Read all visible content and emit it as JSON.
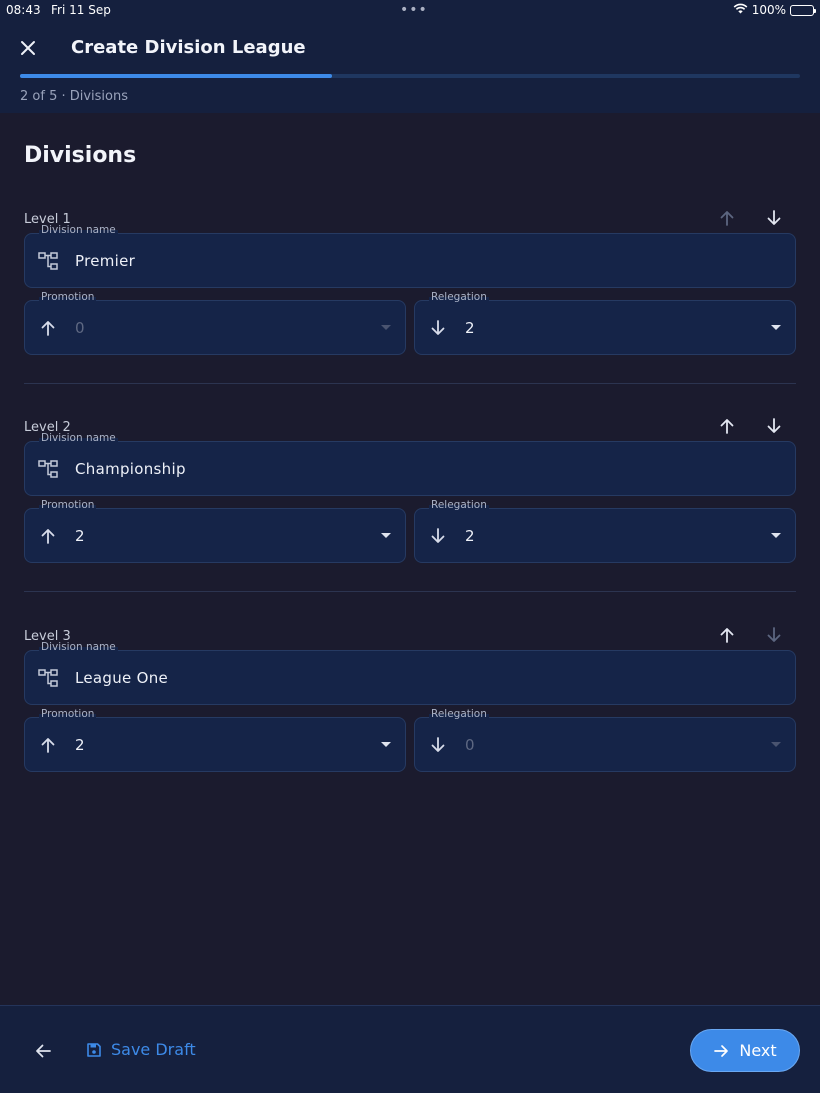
{
  "status_bar": {
    "time": "08:43",
    "date": "Fri 11 Sep",
    "battery": "100%"
  },
  "header": {
    "title": "Create Division League",
    "step_label": "2 of 5 · Divisions",
    "progress_percent": 40
  },
  "section": {
    "title": "Divisions"
  },
  "divisions": [
    {
      "level_label": "Level 1",
      "name_label": "Division name",
      "name_value": "Premier",
      "promotion_label": "Promotion",
      "promotion_value": "0",
      "promotion_disabled": true,
      "relegation_label": "Relegation",
      "relegation_value": "2",
      "relegation_disabled": false,
      "move_up_enabled": false,
      "move_down_enabled": true
    },
    {
      "level_label": "Level 2",
      "name_label": "Division name",
      "name_value": "Championship",
      "promotion_label": "Promotion",
      "promotion_value": "2",
      "promotion_disabled": false,
      "relegation_label": "Relegation",
      "relegation_value": "2",
      "relegation_disabled": false,
      "move_up_enabled": true,
      "move_down_enabled": true
    },
    {
      "level_label": "Level 3",
      "name_label": "Division name",
      "name_value": "League One",
      "promotion_label": "Promotion",
      "promotion_value": "2",
      "promotion_disabled": false,
      "relegation_label": "Relegation",
      "relegation_value": "0",
      "relegation_disabled": true,
      "move_up_enabled": true,
      "move_down_enabled": false
    }
  ],
  "footer": {
    "save_draft_label": "Save Draft",
    "next_label": "Next"
  },
  "colors": {
    "accent": "#3d8ae8",
    "background": "#1b1b2e",
    "header_bg": "#15203e",
    "field_bg": "#152448"
  },
  "icons": {
    "close": "close-icon",
    "tree": "hierarchy-icon",
    "arrow_up": "arrow-up-icon",
    "arrow_down": "arrow-down-icon",
    "back": "arrow-left-icon",
    "save": "floppy-disk-icon",
    "next": "arrow-right-icon",
    "wifi": "wifi-icon",
    "battery": "battery-icon"
  }
}
